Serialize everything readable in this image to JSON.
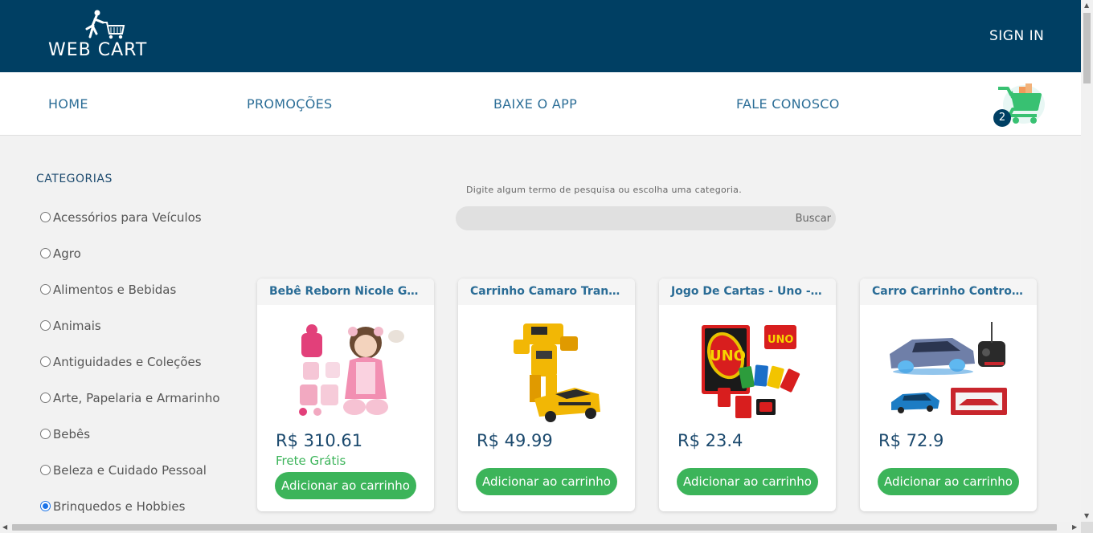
{
  "header": {
    "logo_text": "WEB CART",
    "sign_in": "SIGN IN"
  },
  "nav": {
    "items": [
      "HOME",
      "PROMOÇÕES",
      "BAIXE O APP",
      "FALE CONOSCO"
    ],
    "cart_count": "2"
  },
  "sidebar": {
    "title": "CATEGORIAS",
    "categories": [
      "Acessórios para Veículos",
      "Agro",
      "Alimentos e Bebidas",
      "Animais",
      "Antiguidades e Coleções",
      "Arte, Papelaria e Armarinho",
      "Bebês",
      "Beleza e Cuidado Pessoal",
      "Brinquedos e Hobbies"
    ],
    "selected": "Brinquedos e Hobbies"
  },
  "search": {
    "hint": "Digite algum termo de pesquisa ou escolha uma categoria.",
    "value": "",
    "button": "Buscar"
  },
  "products": [
    {
      "title": "Bebê Reborn Nicole Gi...",
      "price": "R$ 310.61",
      "shipping": "Frete Grátis",
      "button": "Adicionar ao carrinho"
    },
    {
      "title": "Carrinho Camaro Trans...",
      "price": "R$ 49.99",
      "shipping": "",
      "button": "Adicionar ao carrinho"
    },
    {
      "title": "Jogo De Cartas - Uno - ...",
      "price": "R$ 23.4",
      "shipping": "",
      "button": "Adicionar ao carrinho"
    },
    {
      "title": "Carro Carrinho Control...",
      "price": "R$ 72.9",
      "shipping": "",
      "button": "Adicionar ao carrinho"
    }
  ],
  "colors": {
    "header_bg": "#003f63",
    "nav_text": "#2c6e97",
    "accent_green": "#3cb45a"
  }
}
